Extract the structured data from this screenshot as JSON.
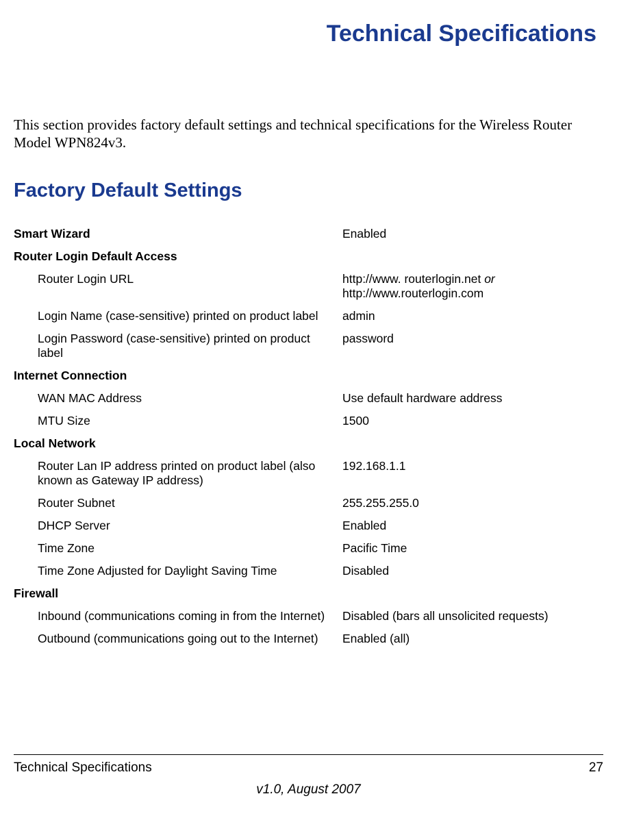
{
  "page_title": "Technical Specifications",
  "intro": "This section provides factory default settings and technical specifications for the Wireless Router Model WPN824v3.",
  "section_heading": "Factory Default Settings",
  "rows": {
    "smart_wizard": {
      "label": "Smart Wizard",
      "value": "Enabled"
    },
    "router_login_header": {
      "label": "Router Login Default Access"
    },
    "router_login_url": {
      "label": "Router Login URL",
      "value_line1": "http://www. routerlogin.net ",
      "value_or": "or",
      "value_line2": "http://www.routerlogin.com"
    },
    "login_name": {
      "label": "Login Name (case-sensitive) printed on product label",
      "value": "admin"
    },
    "login_password": {
      "label": "Login Password (case-sensitive) printed on product label",
      "value": "password"
    },
    "internet_header": {
      "label": "Internet Connection"
    },
    "wan_mac": {
      "label": "WAN MAC Address",
      "value": "Use default hardware address"
    },
    "mtu": {
      "label": "MTU Size",
      "value": "1500"
    },
    "local_network_header": {
      "label": "Local Network"
    },
    "lan_ip": {
      "label": "Router Lan IP address printed on product label (also known as Gateway IP address)",
      "value": "192.168.1.1"
    },
    "subnet": {
      "label": "Router Subnet",
      "value": "255.255.255.0"
    },
    "dhcp": {
      "label": "DHCP Server",
      "value": "Enabled"
    },
    "timezone": {
      "label": "Time Zone",
      "value": "Pacific Time"
    },
    "dst": {
      "label": "Time Zone Adjusted for Daylight Saving Time",
      "value": "Disabled"
    },
    "firewall_header": {
      "label": "Firewall"
    },
    "inbound": {
      "label": "Inbound (communications coming in from the Internet)",
      "value": "Disabled (bars all unsolicited requests)"
    },
    "outbound": {
      "label": "Outbound (communications going out to the Internet)",
      "value": "Enabled (all)"
    }
  },
  "footer": {
    "left": "Technical Specifications",
    "right": "27",
    "version": "v1.0, August 2007"
  }
}
